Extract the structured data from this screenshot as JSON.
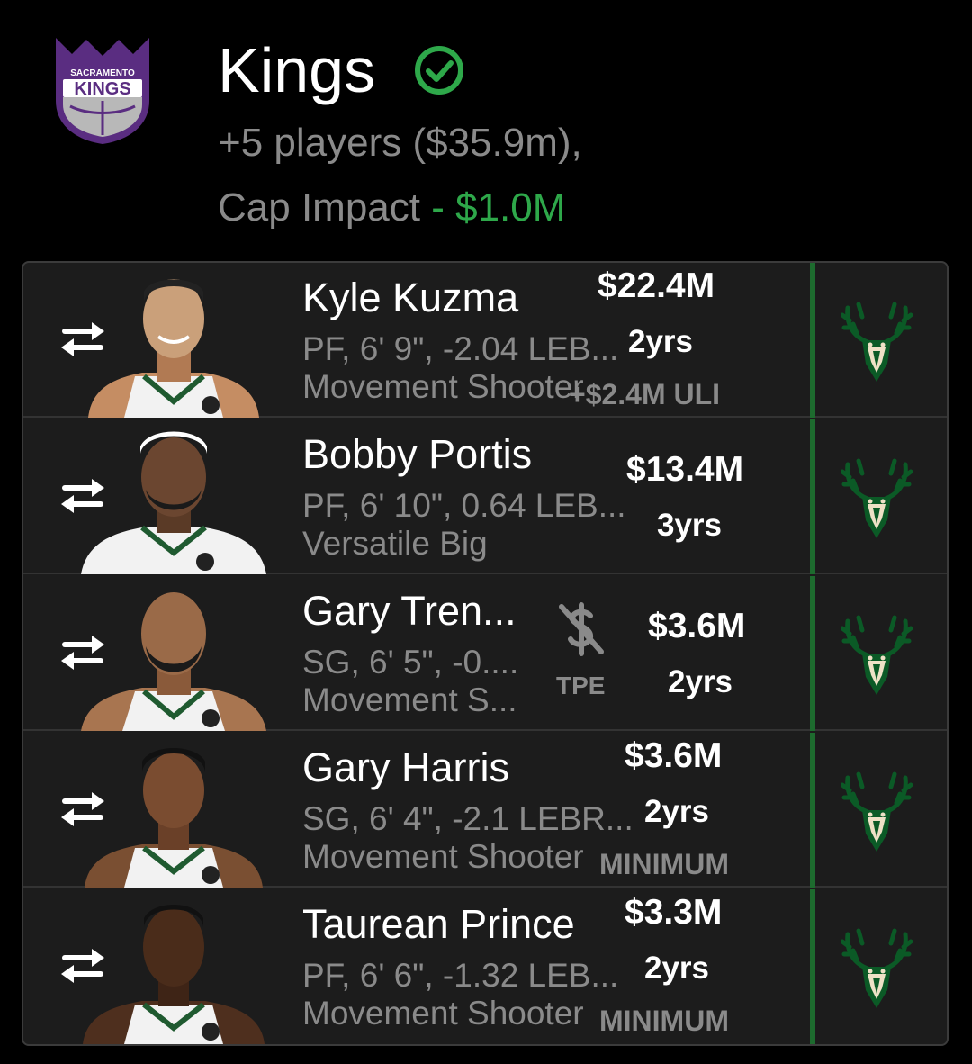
{
  "team": {
    "name": "Kings",
    "logo_text_top": "SACRAMENTO",
    "logo_text_main": "KINGS",
    "players_summary": "+5 players ($35.9m),",
    "cap_label": "Cap Impact",
    "cap_sep": " - ",
    "cap_value": "$1.0M",
    "colors": {
      "accent_green": "#2ea84a",
      "kings_purple": "#5a2d81",
      "bucks_green": "#00471b",
      "bucks_cream": "#eee1c6"
    }
  },
  "players": [
    {
      "name": "Kyle Kuzma",
      "info": "PF, 6' 9\", -2.04 LEB...",
      "archetype": "Movement Shooter",
      "salary": "$22.4M",
      "years": "2yrs",
      "tag": "+$2.4M ULI"
    },
    {
      "name": "Bobby Portis",
      "info": "PF, 6' 10\", 0.64 LEB...",
      "archetype": "Versatile Big",
      "salary": "$13.4M",
      "years": "3yrs",
      "tag": ""
    },
    {
      "name": "Gary Tren...",
      "info": "SG, 6' 5\", -0....",
      "archetype": "Movement S...",
      "salary": "$3.6M",
      "years": "2yrs",
      "tag": "",
      "tpe": "TPE"
    },
    {
      "name": "Gary Harris",
      "info": "SG, 6' 4\", -2.1 LEBR...",
      "archetype": "Movement Shooter",
      "salary": "$3.6M",
      "years": "2yrs",
      "tag": "MINIMUM"
    },
    {
      "name": "Taurean Prince",
      "info": "PF, 6' 6\", -1.32 LEB...",
      "archetype": "Movement Shooter",
      "salary": "$3.3M",
      "years": "2yrs",
      "tag": "MINIMUM"
    }
  ],
  "icons": {
    "swap": "swap-arrows-icon",
    "verified": "check-circle-icon",
    "team_logo": "bucks-logo-icon",
    "tpe": "no-dollar-icon"
  }
}
